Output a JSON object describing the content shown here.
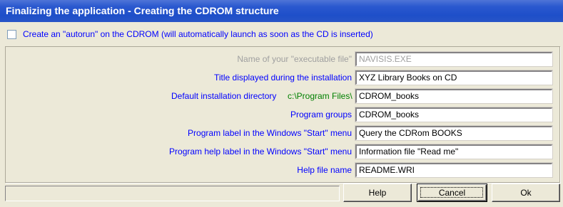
{
  "window": {
    "title": "Finalizing the application - Creating the CDROM structure"
  },
  "autorun": {
    "checked": false,
    "label": "Create an \"autorun\" on the CDROM (will automatically launch as soon as the CD is inserted)"
  },
  "fields": {
    "executable": {
      "label": "Name of your \"executable file\"",
      "value": "NAVISIS.EXE",
      "enabled": false
    },
    "title": {
      "label": "Title displayed during the installation",
      "value": "XYZ Library Books on CD"
    },
    "install_dir": {
      "label": "Default installation directory",
      "prefix": "c:\\Program Files\\",
      "value": "CDROM_books"
    },
    "program_groups": {
      "label": "Program groups",
      "value": "CDROM_books"
    },
    "program_label": {
      "label": "Program label in the Windows \"Start\" menu",
      "value": "Query the CDRom BOOKS"
    },
    "help_label": {
      "label": "Program help label in the Windows \"Start\" menu",
      "value": "Information file \"Read me\""
    },
    "help_file": {
      "label": "Help file name",
      "value": "README.WRI"
    }
  },
  "status": {
    "text": ""
  },
  "buttons": {
    "help": "Help",
    "cancel": "Cancel",
    "ok": "Ok"
  },
  "colors": {
    "label_blue": "#0000ff",
    "prefix_green": "#008000",
    "disabled_gray": "#a0a0a0",
    "titlebar_blue": "#2a58cf"
  }
}
